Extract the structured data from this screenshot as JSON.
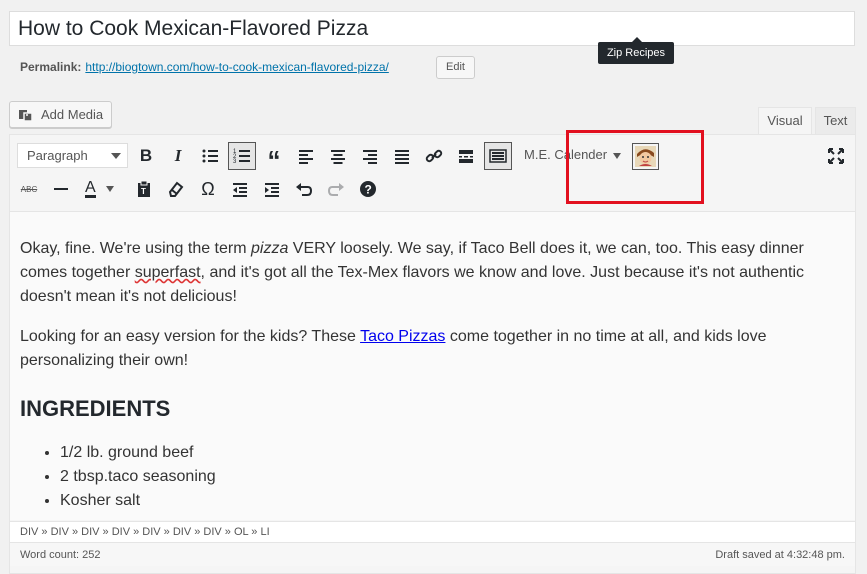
{
  "post": {
    "title": "How to Cook Mexican-Flavored Pizza",
    "permalink_label": "Permalink:",
    "permalink_url": "http://biogtown.com/how-to-cook-mexican-flavored-pizza/",
    "edit_label": "Edit"
  },
  "media": {
    "add_media_label": "Add Media"
  },
  "tabs": {
    "visual": "Visual",
    "text": "Text"
  },
  "toolbar": {
    "format_value": "Paragraph",
    "calendar_label": "M.E. Calender",
    "tooltip": "Zip Recipes",
    "icons_row1": [
      "bold-icon",
      "italic-icon",
      "bullet-list-icon",
      "numbered-list-icon",
      "blockquote-icon",
      "align-left-icon",
      "align-center-icon",
      "align-right-icon",
      "justify-icon",
      "link-icon",
      "read-more-icon",
      "toolbar-toggle-icon",
      "zip-recipes-icon",
      "fullscreen-icon"
    ],
    "icons_row2": [
      "strikethrough-icon",
      "horizontal-line-icon",
      "text-color-icon",
      "paste-text-icon",
      "clear-formatting-icon",
      "special-character-icon",
      "outdent-icon",
      "indent-icon",
      "undo-icon",
      "redo-icon",
      "help-icon"
    ],
    "text_color_letter": "A",
    "strike_text": "ABC"
  },
  "content": {
    "p1_a": "Okay, fine. We're using the term ",
    "p1_em": "pizza",
    "p1_b": " VERY loosely. We say, if Taco Bell does it, we can, too. This easy dinner comes together ",
    "p1_squiggle": "superfast",
    "p1_c": ", and it's got all the Tex-Mex flavors we know and love. Just because it's not authentic doesn't mean it's not delicious!",
    "p2_a": "Looking for an easy version for the kids? These ",
    "p2_link": "Taco Pizzas",
    "p2_b": " come together in no time at all, and kids love personalizing their own!",
    "heading": "INGREDIENTS",
    "ingredients": [
      "1/2 lb. ground beef",
      "2 tbsp.taco seasoning",
      "Kosher salt"
    ]
  },
  "path": "DIV » DIV » DIV » DIV » DIV » DIV » DIV » OL » LI",
  "status": {
    "word_count": "Word count: 252",
    "saved": "Draft saved at 4:32:48 pm."
  },
  "colors": {
    "highlight": "#e2101f",
    "link": "#0073aa"
  }
}
